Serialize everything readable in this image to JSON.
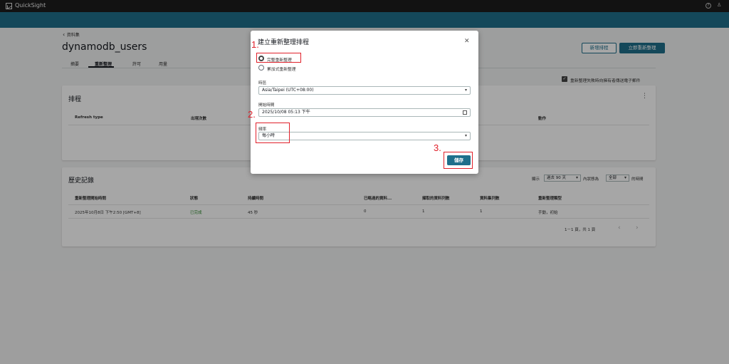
{
  "topbar": {
    "app_name": "QuickSight",
    "help_icon": "question-icon",
    "user_icon": "user-icon"
  },
  "header": {
    "back_label": "資料集",
    "title": "dynamodb_users",
    "tabs": [
      "摘要",
      "重新整理",
      "許可",
      "用量"
    ],
    "active_tab": 1,
    "add_schedule": "新增排程",
    "refresh_now": "立即重新整理",
    "email_label": "重新整理失敗時向擁有者傳送電子郵件"
  },
  "schedule": {
    "title": "排程",
    "columns": [
      "Refresh type",
      "出現次數",
      "動作"
    ]
  },
  "history": {
    "title": "歷史記錄",
    "show_label": "顯示",
    "range_value": "過去 90 天",
    "status_label": "內狀態為",
    "status_value": "全部",
    "suffix": "的時間",
    "columns": [
      "重新整理開始時間",
      "狀態",
      "持續時間",
      "已略過的資料...",
      "擷取的資料列數",
      "資料集列數",
      "重新整理類型"
    ],
    "rows": [
      {
        "start": "2025年10月8日 下午2:50 [GMT+8]",
        "status": "已完成",
        "duration": "45 秒",
        "skipped": "0",
        "ingested": "1",
        "dataset_rows": "1",
        "type": "手動，初始"
      }
    ],
    "pagination": "1－1 頁，共 1 頁"
  },
  "modal": {
    "title": "建立重新整理排程",
    "radio_full": "完整重新整理",
    "radio_incremental": "累加式重新整理",
    "timezone_label": "時區",
    "timezone_value": "Asia/Taipei (UTC+08:00)",
    "start_label": "開始時間",
    "start_value": "2025/10/08 05:13 下午",
    "frequency_label": "頻率",
    "frequency_value": "每小時",
    "save_label": "儲存"
  },
  "annotations": {
    "one": "1.",
    "two": "2.",
    "three": "3."
  },
  "colors": {
    "accent": "#1f6f8b",
    "annotation": "#e0202a",
    "success": "#2d8a2d"
  }
}
